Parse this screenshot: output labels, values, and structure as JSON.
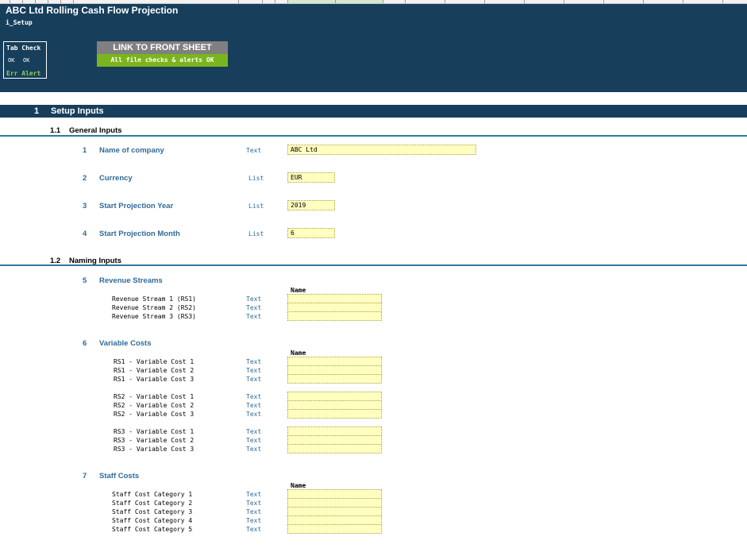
{
  "header": {
    "title": "ABC Ltd Rolling Cash Flow Projection",
    "sheet": "i_Setup",
    "tab_check": {
      "label": "Tab Check",
      "status1": "OK",
      "status2": "OK",
      "alert": "Err Alert"
    },
    "link_button": "LINK TO FRONT SHEET",
    "checks_status": "All file checks & alerts OK"
  },
  "section": {
    "number": "1",
    "title": "Setup Inputs"
  },
  "general": {
    "number": "1.1",
    "title": "General Inputs",
    "items": [
      {
        "num": "1",
        "label": "Name of company",
        "type": "Text",
        "value": "ABC Ltd"
      },
      {
        "num": "2",
        "label": "Currency",
        "type": "List",
        "value": "EUR"
      },
      {
        "num": "3",
        "label": "Start Projection Year",
        "type": "List",
        "value": "2019"
      },
      {
        "num": "4",
        "label": "Start Projection Month",
        "type": "List",
        "value": "6"
      }
    ]
  },
  "naming": {
    "number": "1.2",
    "title": "Naming Inputs",
    "name_header": "Name",
    "revenue": {
      "num": "5",
      "title": "Revenue Streams",
      "rows": [
        "Revenue Stream 1 (RS1)",
        "Revenue Stream 2 (RS2)",
        "Revenue Stream 3 (RS3)"
      ]
    },
    "variable": {
      "num": "6",
      "title": "Variable Costs",
      "groups": [
        [
          "RS1 - Variable Cost 1",
          "RS1 - Variable Cost 2",
          "RS1 - Variable Cost 3"
        ],
        [
          "RS2 - Variable Cost 1",
          "RS2 - Variable Cost 2",
          "RS2 - Variable Cost 3"
        ],
        [
          "RS3 - Variable Cost 1",
          "RS3 - Variable Cost 2",
          "RS3 - Variable Cost 3"
        ]
      ]
    },
    "staff": {
      "num": "7",
      "title": "Staff Costs",
      "rows": [
        "Staff Cost Category 1",
        "Staff Cost Category 2",
        "Staff Cost Category 3",
        "Staff Cost Category 4",
        "Staff Cost Category 5"
      ]
    },
    "row_type": "Text"
  }
}
